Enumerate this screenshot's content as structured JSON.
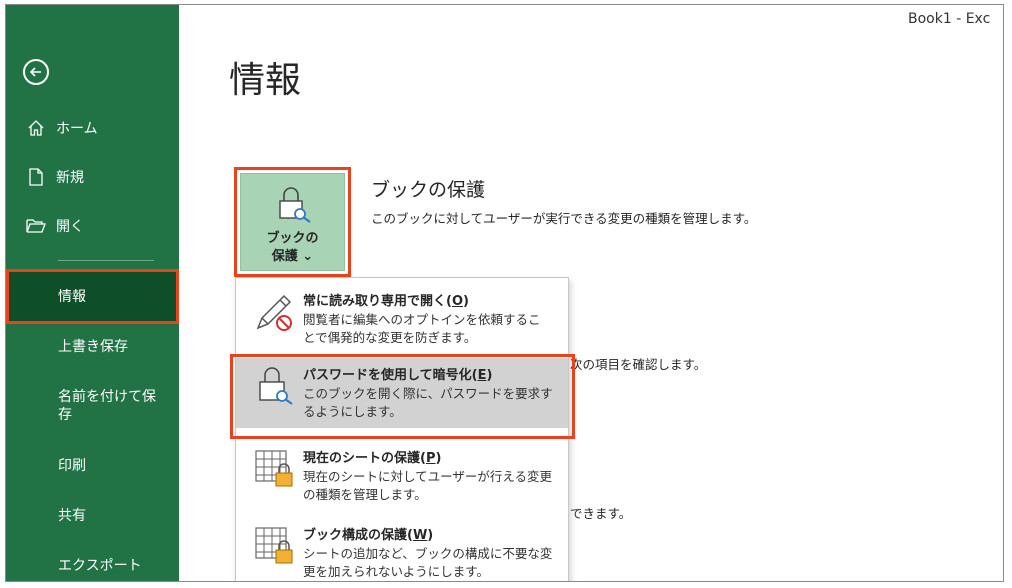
{
  "window": {
    "title": "Book1  -  Exc"
  },
  "sidebar": {
    "back_icon": "back-arrow-icon",
    "items": [
      {
        "label": "ホーム",
        "icon": "home-icon"
      },
      {
        "label": "新規",
        "icon": "new-file-icon"
      },
      {
        "label": "開く",
        "icon": "folder-open-icon"
      },
      {
        "label": "情報"
      },
      {
        "label": "上書き保存"
      },
      {
        "label": "名前を付けて保存"
      },
      {
        "label": "印刷"
      },
      {
        "label": "共有"
      },
      {
        "label": "エクスポート"
      }
    ],
    "selected": "情報",
    "bg_color": "#217346",
    "selected_color": "#0e4f2a"
  },
  "main": {
    "page_title": "情報",
    "protect_button": {
      "line1": "ブックの",
      "line2": "保護 ⌄"
    },
    "section": {
      "title": "ブックの保護",
      "description": "このブックに対してユーザーが実行できる変更の種類を管理します。"
    },
    "partial_texts": [
      "次の項目を確認します。",
      "できます。"
    ]
  },
  "dropdown": {
    "items": [
      {
        "title_pre": "常に読み取り専用で開く(",
        "accel": "O",
        "title_post": ")",
        "desc": "閲覧者に編集へのオプトインを依頼することで偶発的な変更を防ぎます。",
        "icon": "pencil-no-icon"
      },
      {
        "title_pre": "パスワードを使用して暗号化(",
        "accel": "E",
        "title_post": ")",
        "desc": "このブックを開く際に、パスワードを要求するようにします。",
        "icon": "lock-key-icon",
        "highlighted": true
      },
      {
        "title_pre": "現在のシートの保護(",
        "accel": "P",
        "title_post": ")",
        "desc": "現在のシートに対してユーザーが行える変更の種類を管理します。",
        "icon": "sheet-lock-icon"
      },
      {
        "title_pre": "ブック構成の保護(",
        "accel": "W",
        "title_post": ")",
        "desc": "シートの追加など、ブックの構成に不要な変更を加えられないようにします。",
        "icon": "workbook-lock-icon"
      }
    ]
  },
  "colors": {
    "accent_highlight": "#e8431d",
    "protect_bg": "#a8d3b5"
  }
}
